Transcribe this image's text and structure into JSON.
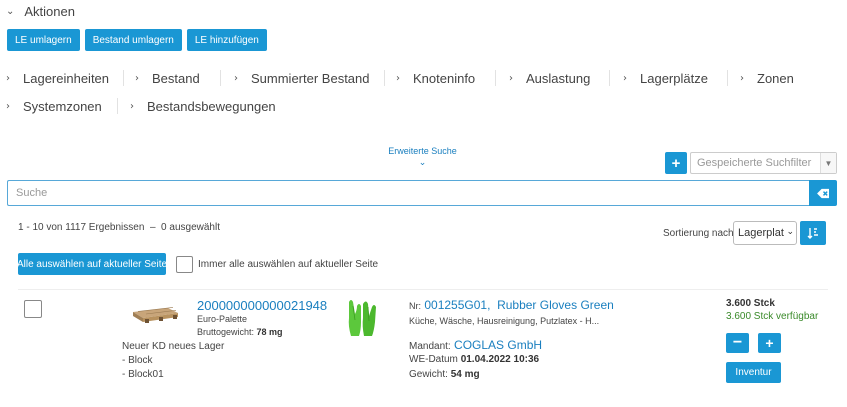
{
  "section": {
    "title": "Aktionen"
  },
  "actions": [
    "LE umlagern",
    "Bestand umlagern",
    "LE hinzufügen"
  ],
  "tabs": [
    "Lagereinheiten",
    "Bestand",
    "Summierter Bestand",
    "Knoteninfo",
    "Auslastung",
    "Lagerplätze",
    "Zonen",
    "Systemzonen",
    "Bestandsbewegungen"
  ],
  "search": {
    "advanced_label": "Erweiterte Suche",
    "saved_filter_placeholder": "Gespeicherte Suchfilter",
    "placeholder": "Suche",
    "value": ""
  },
  "results": {
    "count_text": "1 - 10 von 1117 Ergebnissen  –  0 ausgewählt",
    "sort_label": "Sortierung nach",
    "sort_value": "Lagerplatz",
    "select_all_label": "Alle auswählen auf aktueller Seite",
    "always_select_label": "Immer alle auswählen auf aktueller Seite"
  },
  "item": {
    "id": "200000000000021948",
    "type": "Euro-Palette",
    "weight_label": "Bruttogewicht:",
    "weight_value": "78 mg",
    "location_lines": [
      "Neuer KD neues Lager",
      "- Block",
      "- Block01"
    ],
    "nr_label": "Nr:",
    "nr_value": "001255G01,  Rubber Gloves Green",
    "description": "Küche, Wäsche, Hausreinigung, Putzlatex - H...",
    "mandant_label": "Mandant:",
    "mandant_value": "COGLAS GmbH",
    "we_label": "WE-Datum",
    "we_value": "01.04.2022 10:36",
    "gewicht_label": "Gewicht:",
    "gewicht_value": "54 mg",
    "stock_total": "3.600 Stck",
    "stock_available": "3.600 Stck verfügbar",
    "inventur_label": "Inventur"
  },
  "colors": {
    "primary": "#1a97d4",
    "link": "#1a7fbf",
    "available": "#3a8a2a"
  },
  "icons": [
    "chevron-down-icon",
    "chevron-right-icon",
    "plus-icon",
    "eraser-icon",
    "sort-icon",
    "pallet-image",
    "glove-image"
  ]
}
